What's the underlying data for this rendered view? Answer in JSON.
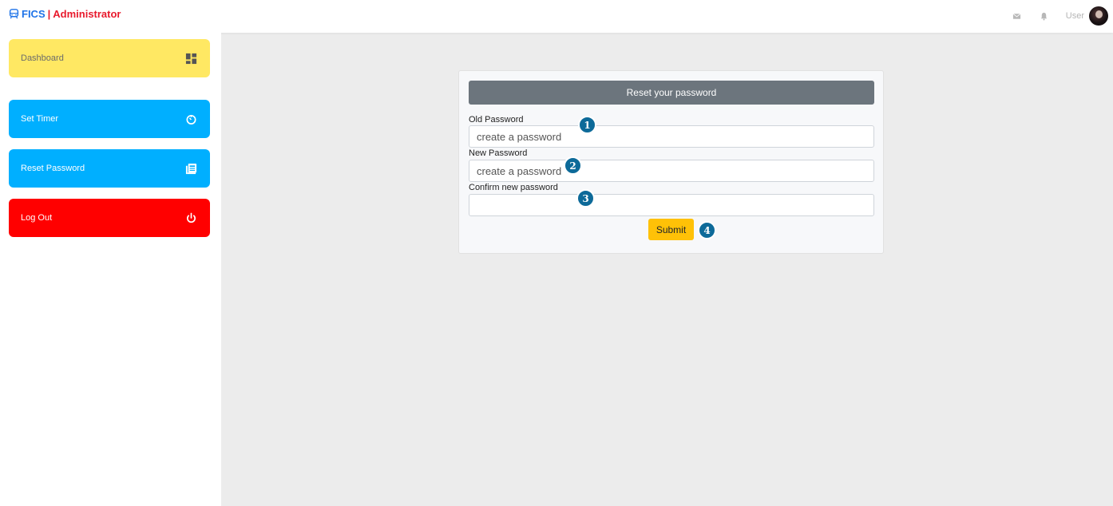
{
  "brand": {
    "name": "FICS",
    "separator": "|",
    "role": "Administrator",
    "icon": "bus-icon",
    "colors": {
      "name": "#1e73e8",
      "role": "#e8192c"
    }
  },
  "topbar": {
    "mail_icon": "mail-icon",
    "bell_icon": "bell-icon",
    "user_label": "User",
    "avatar": "avatar-image"
  },
  "sidebar": {
    "items": [
      {
        "label": "Dashboard",
        "icon": "dashboard-icon",
        "color": "#ffe863"
      },
      {
        "label": "Set Timer",
        "icon": "timer-icon",
        "color": "#00afff"
      },
      {
        "label": "Reset Password",
        "icon": "newspaper-icon",
        "color": "#00afff"
      },
      {
        "label": "Log Out",
        "icon": "power-icon",
        "color": "#ff0000"
      }
    ]
  },
  "form": {
    "title": "Reset your password",
    "fields": [
      {
        "label": "Old Password",
        "value": "",
        "placeholder": "create a password"
      },
      {
        "label": "New Password",
        "value": "",
        "placeholder": "create a password"
      },
      {
        "label": "Confirm new password",
        "value": "",
        "placeholder": ""
      }
    ],
    "submit_label": "Submit",
    "submit_color": "#ffc107",
    "header_color": "#6c757d"
  },
  "markers": [
    "1",
    "2",
    "3",
    "4"
  ]
}
